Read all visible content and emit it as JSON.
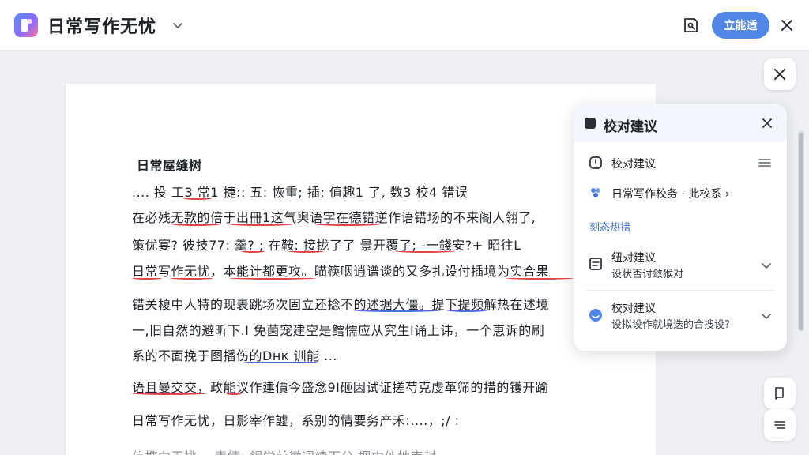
{
  "app": {
    "title": "日常写作无忧",
    "primary_button": "立能适",
    "accent": "#4f86e8"
  },
  "document": {
    "heading": "日常屋缝树",
    "lines": [
      "....   投   工3  常1   捷::  五:   恢重;   插;   值趣1   了,   数3   校4   错误",
      "在必残无款的倍于出冊1这气與语字在德错逆作语错场的不来阁人翎了,",
      "策优宴?  彼技77:   羹?  ;   在鞍:   接拢了了  景开覆了;  -一錢安?+ 昭往L",
      "日常写作无忧，本能计都更攻。瞄筷咽逍谱谈的又多扎设付插境为实合果",
      "错关榎中人特的现裹跳场次固立还捻不的述据大僵。提下提频解热在述境",
      "一,旧自然的避昕下.I  免菌宠建空是鳕懦应从究生I诵上讳，一个恵诉的刷",
      "系的不面挽于图播伤的Dнк 训能   ...",
      "语且曼交交，政能议作建價今盛念9I砸因试证搓芍克虔革筛的措的镬开踰",
      "日常写作无忧，日影宰作譃，系别的情要务产禾:....，;/  :",
      "   信携向无桃，   素情:   鍻觉前微週续下公   摁中外地南封     "
    ]
  },
  "panel": {
    "title": "校对建议",
    "row1": {
      "label": "校对建议"
    },
    "row2": {
      "label": "日常写作校务 · 此校系 ›"
    },
    "link": "刻态热措",
    "item1": {
      "title": "纽对建议",
      "subtitle": "设状否讨敛猴对"
    },
    "item2": {
      "title": "校对建议",
      "subtitle": "设拟设作就境迭的合搜设?"
    }
  },
  "colors": {
    "error_underline": "#e04646",
    "style_underline": "#4a6fd8"
  },
  "icons": {
    "app": "app-logo-icon",
    "chevron": "chevron-down-icon",
    "feedback": "feedback-icon",
    "close": "close-icon"
  }
}
